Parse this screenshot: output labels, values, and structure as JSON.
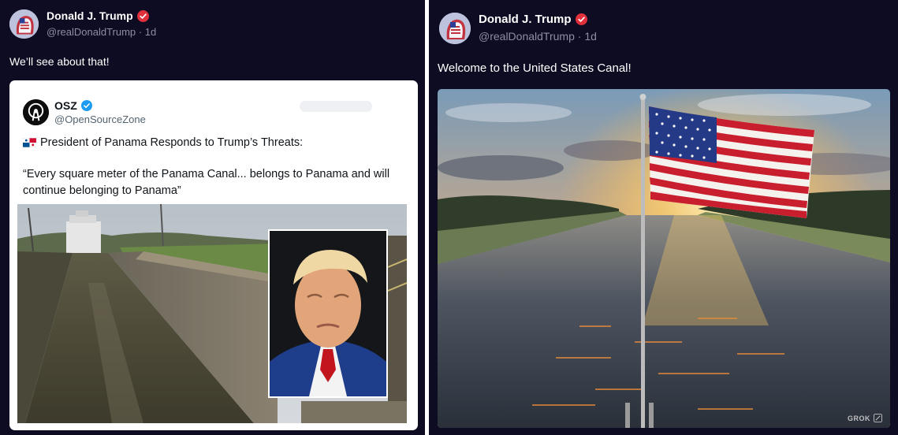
{
  "left_post": {
    "author": {
      "display_name": "Donald J. Trump",
      "handle": "@realDonaldTrump",
      "separator": "·",
      "age": "1d"
    },
    "text": "We’ll see about that!",
    "quoted_post": {
      "author": {
        "display_name": "OSZ",
        "handle": "@OpenSourceZone"
      },
      "headline": "President of Panama Responds to Trump’s Threats:",
      "quote": "“Every square meter of the Panama Canal... belongs to Panama and will continue belonging to Panama”",
      "image_icon": "canal-lock-photo-with-trump-inset"
    }
  },
  "right_post": {
    "author": {
      "display_name": "Donald J. Trump",
      "handle": "@realDonaldTrump",
      "separator": "·",
      "age": "1d"
    },
    "text": "Welcome to the United States Canal!",
    "image_icon": "canal-sunset-american-flag-image",
    "watermark": "GROK"
  },
  "colors": {
    "post_background": "#0e0c22",
    "text_primary": "#ffffff",
    "text_secondary": "#8e8ca6",
    "verified_badge_red": "#e0303c",
    "quote_verified_blue": "#1d9bf0"
  }
}
